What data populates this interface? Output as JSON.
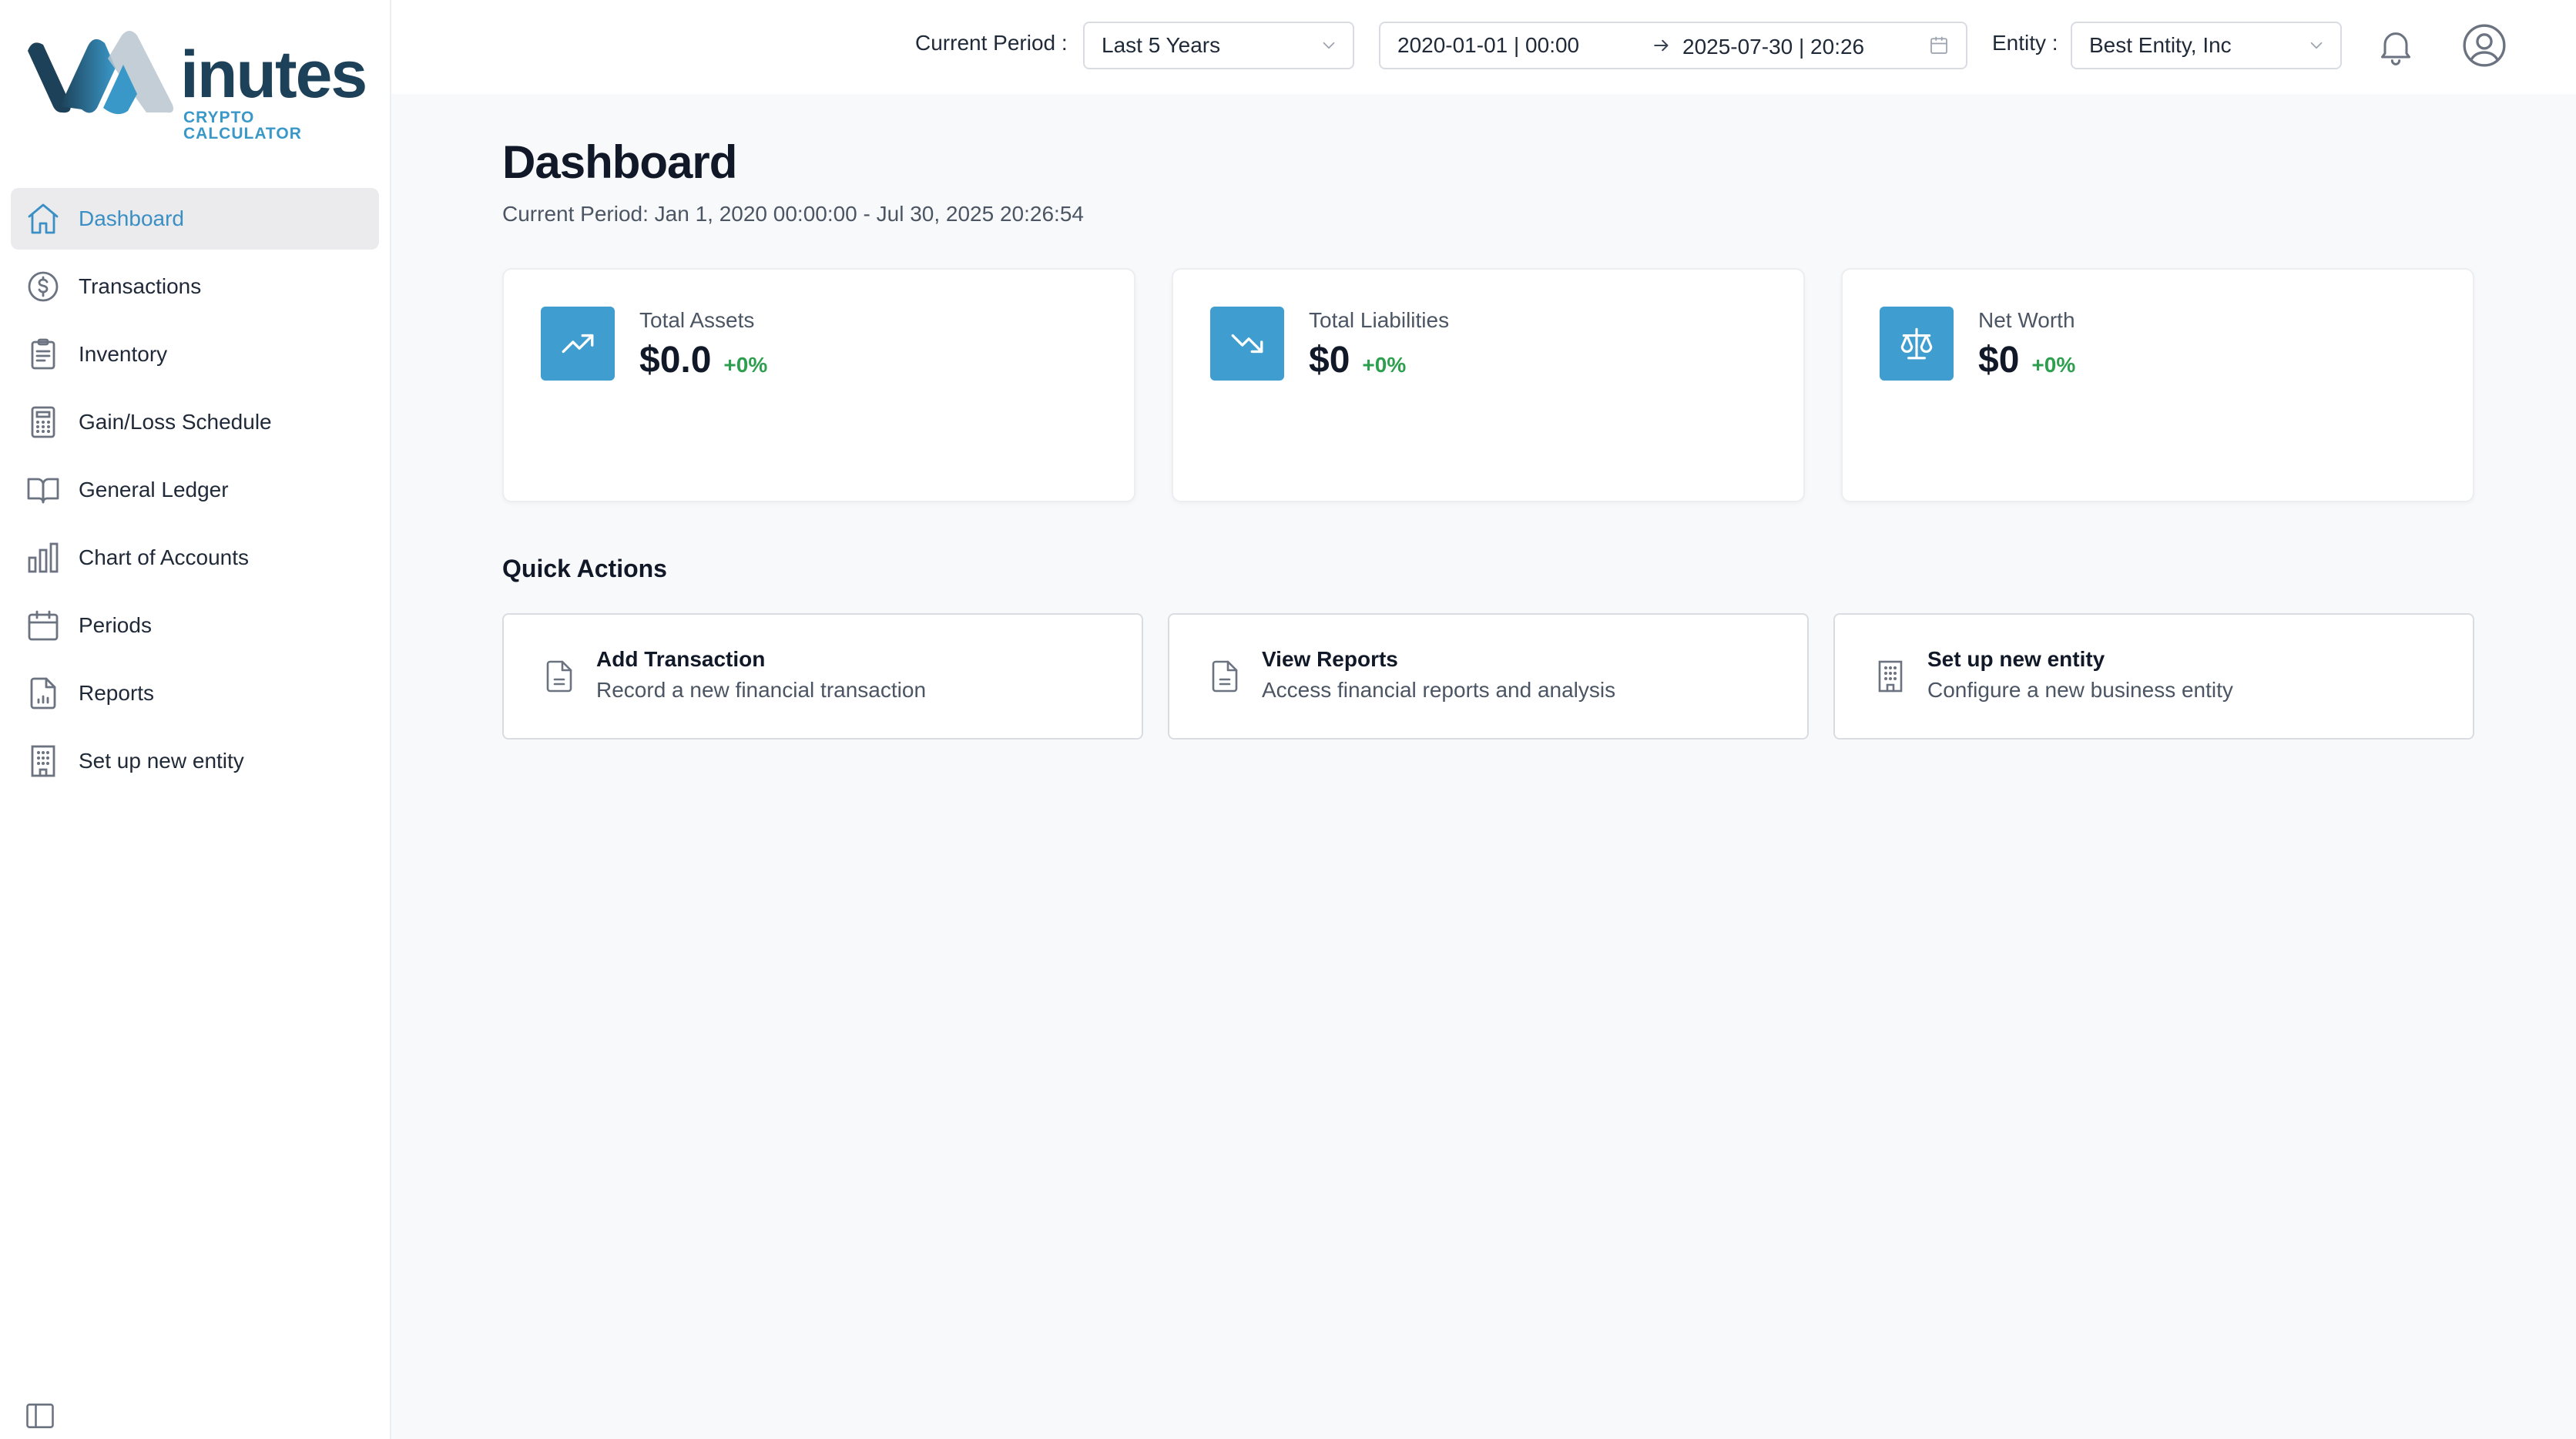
{
  "app": {
    "logo_word": "inutes",
    "logo_sub": "CRYPTO CALCULATOR"
  },
  "sidebar": {
    "items": [
      {
        "label": "Dashboard",
        "icon": "home-icon",
        "active": true
      },
      {
        "label": "Transactions",
        "icon": "dollar-circle-icon"
      },
      {
        "label": "Inventory",
        "icon": "clipboard-icon"
      },
      {
        "label": "Gain/Loss Schedule",
        "icon": "calculator-icon"
      },
      {
        "label": "General Ledger",
        "icon": "book-open-icon"
      },
      {
        "label": "Chart of Accounts",
        "icon": "bar-chart-icon"
      },
      {
        "label": "Periods",
        "icon": "calendar-icon"
      },
      {
        "label": "Reports",
        "icon": "file-chart-icon"
      },
      {
        "label": "Set up new entity",
        "icon": "building-icon"
      }
    ],
    "collapse_icon": "sidebar-toggle-icon"
  },
  "topbar": {
    "period_label": "Current Period :",
    "period_value": "Last 5 Years",
    "date_start": "2020-01-01 | 00:00",
    "date_end": "2025-07-30 | 20:26",
    "entity_label": "Entity :",
    "entity_value": "Best Entity, Inc"
  },
  "main": {
    "title": "Dashboard",
    "subtitle": "Current Period: Jan 1, 2020 00:00:00 - Jul 30, 2025 20:26:54",
    "stats": [
      {
        "label": "Total Assets",
        "value": "$0.0",
        "change": "+0%",
        "icon": "trending-up-icon"
      },
      {
        "label": "Total Liabilities",
        "value": "$0",
        "change": "+0%",
        "icon": "trending-down-icon"
      },
      {
        "label": "Net Worth",
        "value": "$0",
        "change": "+0%",
        "icon": "scale-icon"
      }
    ],
    "quick_actions_title": "Quick Actions",
    "quick_actions": [
      {
        "title": "Add Transaction",
        "desc": "Record a new financial transaction",
        "icon": "file-icon"
      },
      {
        "title": "View Reports",
        "desc": "Access financial reports and analysis",
        "icon": "file-icon"
      },
      {
        "title": "Set up new entity",
        "desc": "Configure a new business entity",
        "icon": "building-icon"
      }
    ]
  },
  "colors": {
    "accent": "#3f9dd0",
    "positive": "#2e9e4f",
    "brand_dark": "#1d4158",
    "active_bg": "#ebebed"
  }
}
